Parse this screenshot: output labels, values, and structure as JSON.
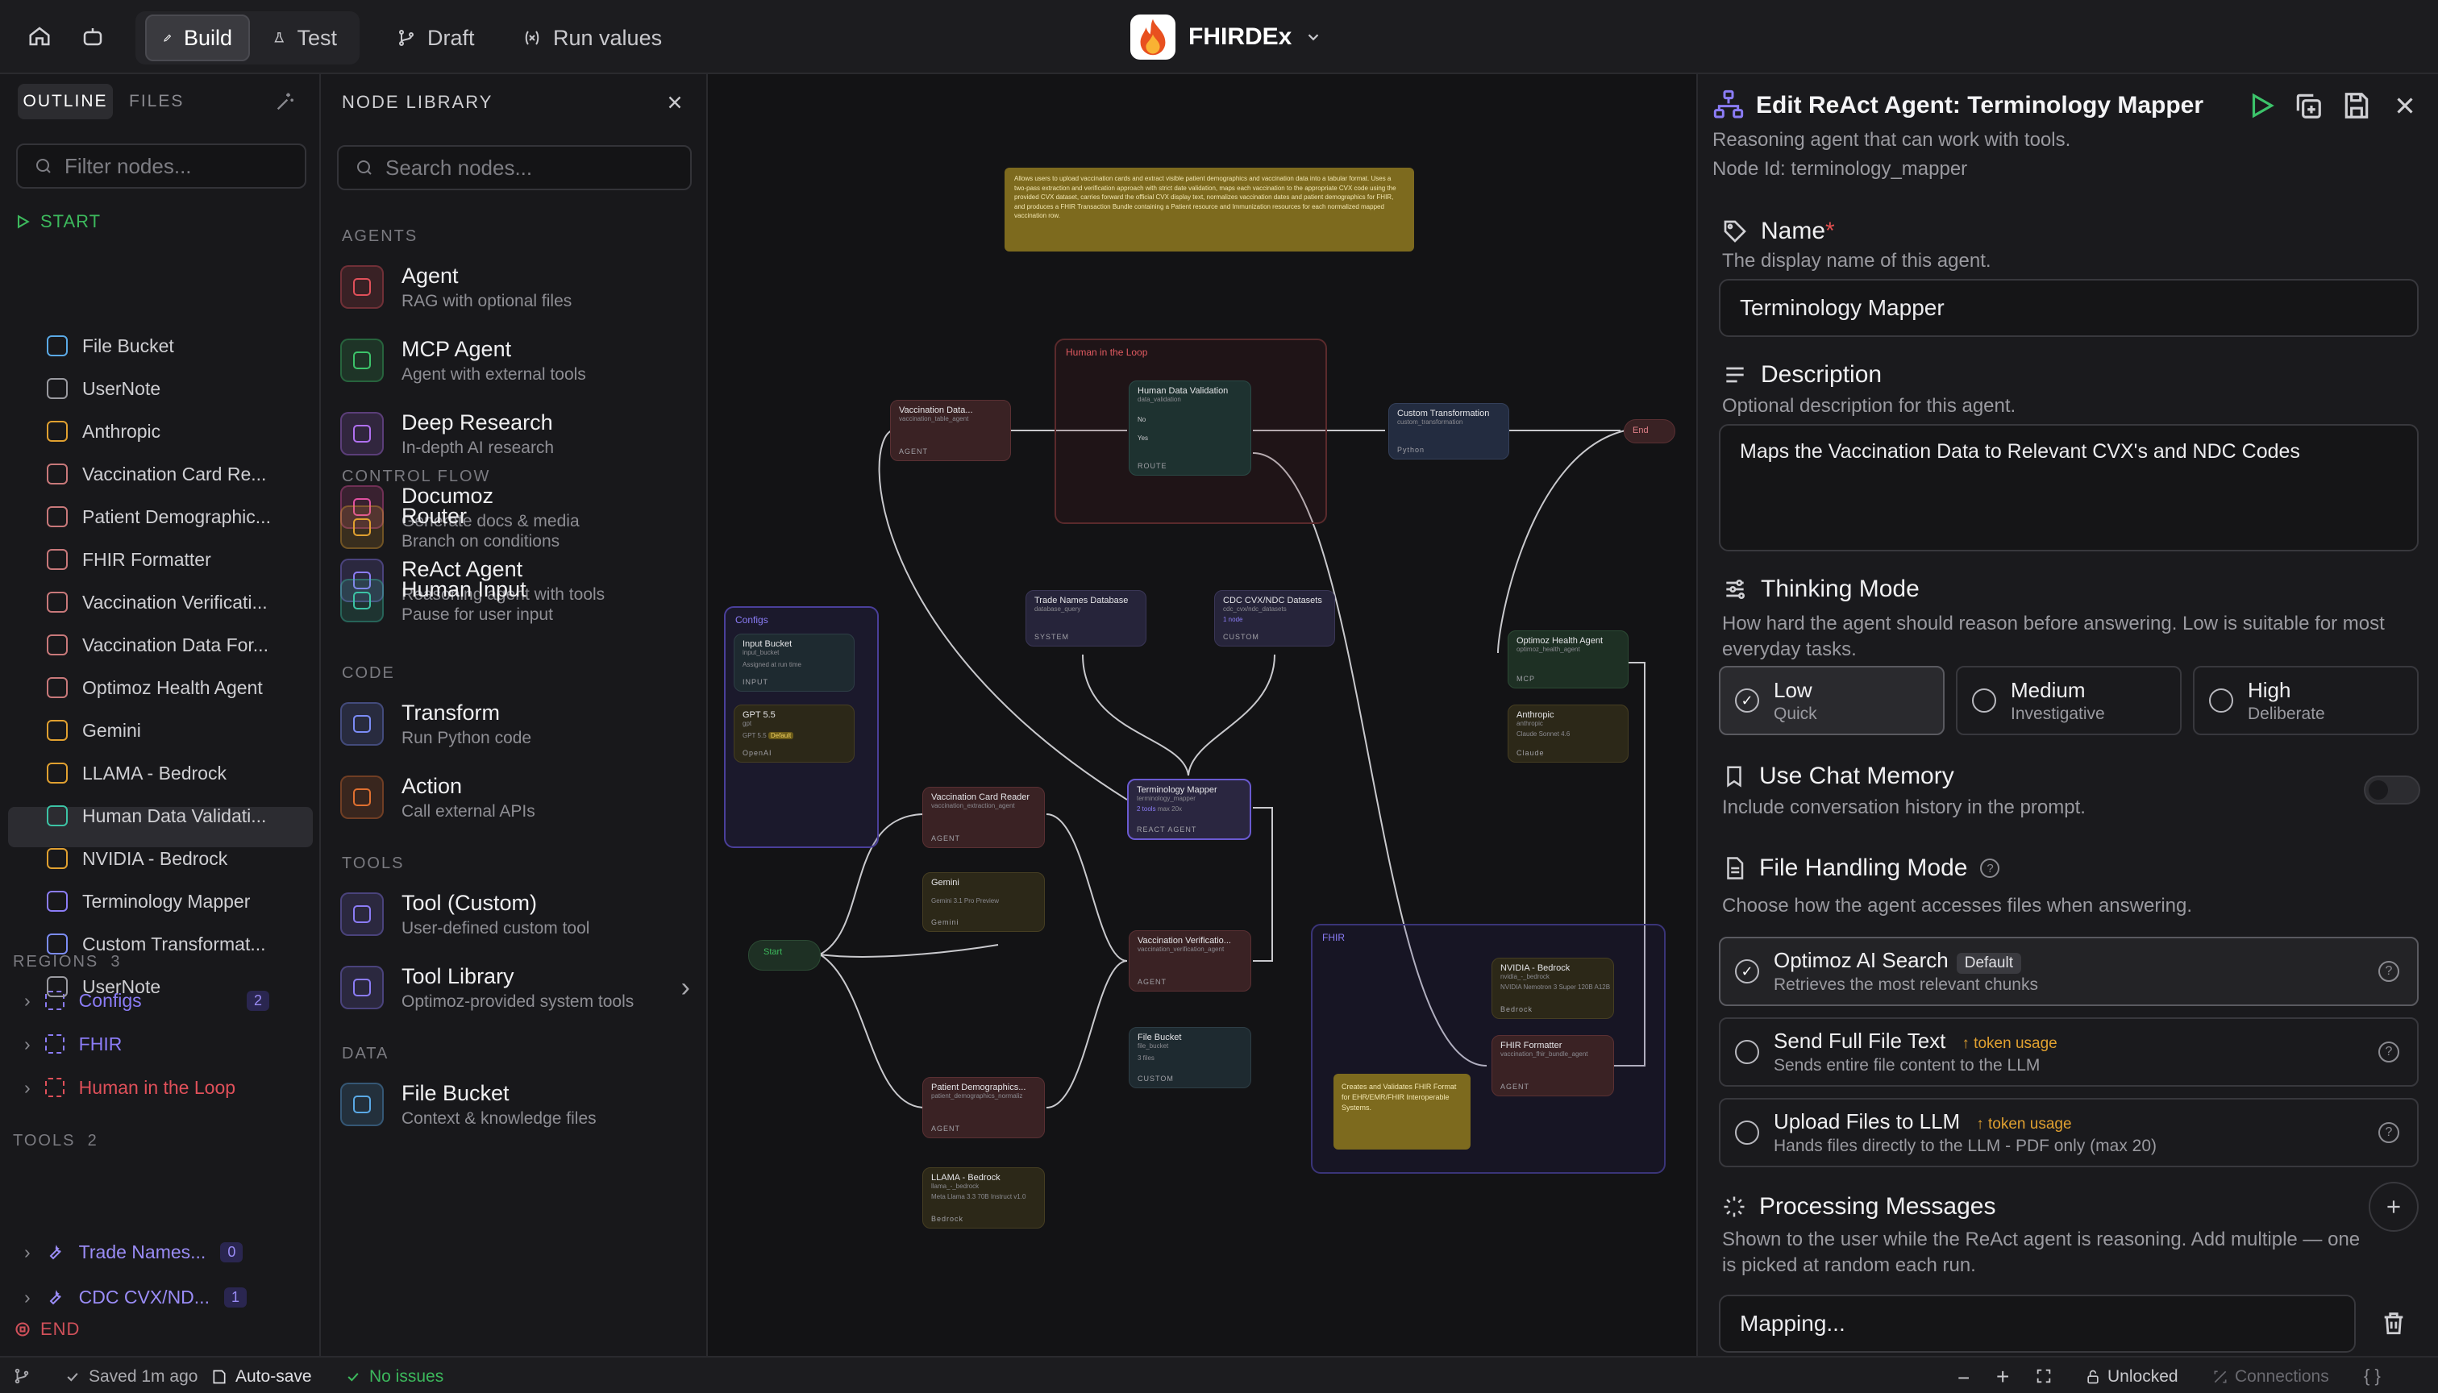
{
  "topbar": {
    "build": "Build",
    "test": "Test",
    "draft": "Draft",
    "run_values": "Run values",
    "app_name": "FHIRDEx"
  },
  "outline": {
    "tab_outline": "OUTLINE",
    "tab_files": "FILES",
    "filter_placeholder": "Filter nodes...",
    "start": "START",
    "items": [
      {
        "label": "File Bucket",
        "color": "#5aa9e6"
      },
      {
        "label": "UserNote",
        "color": "#9a9aa0"
      },
      {
        "label": "Anthropic",
        "color": "#e0a030"
      },
      {
        "label": "Vaccination Card Re...",
        "color": "#c8787a"
      },
      {
        "label": "Patient Demographic...",
        "color": "#c8787a"
      },
      {
        "label": "FHIR Formatter",
        "color": "#c8787a"
      },
      {
        "label": "Vaccination Verificati...",
        "color": "#c8787a"
      },
      {
        "label": "Vaccination Data For...",
        "color": "#c8787a"
      },
      {
        "label": "Optimoz Health Agent",
        "color": "#c8787a"
      },
      {
        "label": "Gemini",
        "color": "#e0a030"
      },
      {
        "label": "LLAMA - Bedrock",
        "color": "#e0a030"
      },
      {
        "label": "Human Data Validati...",
        "color": "#3cc3a5"
      },
      {
        "label": "NVIDIA - Bedrock",
        "color": "#e0a030"
      },
      {
        "label": "Terminology Mapper",
        "color": "#8b7cf6"
      },
      {
        "label": "Custom Transformat...",
        "color": "#7b8cf6"
      },
      {
        "label": "UserNote",
        "color": "#9a9aa0"
      }
    ],
    "regions_label": "REGIONS",
    "regions_count": "3",
    "regions": [
      {
        "label": "Configs",
        "count": "2",
        "color": "#8b7cf6"
      },
      {
        "label": "FHIR",
        "color": "#8b7cf6"
      },
      {
        "label": "Human in the Loop",
        "color": "#e0505a"
      }
    ],
    "tools_label": "TOOLS",
    "tools_count": "2",
    "tools": [
      {
        "label": "Trade Names...",
        "count": "0"
      },
      {
        "label": "CDC CVX/ND...",
        "count": "1"
      }
    ],
    "end": "END"
  },
  "library": {
    "title": "NODE LIBRARY",
    "search_placeholder": "Search nodes...",
    "sections": {
      "agents": "AGENTS",
      "control": "CONTROL FLOW",
      "code": "CODE",
      "tools": "TOOLS",
      "data": "DATA"
    },
    "agents": [
      {
        "name": "Agent",
        "desc": "RAG with optional files",
        "color": "#e0505a",
        "icon": "agent-icon"
      },
      {
        "name": "MCP Agent",
        "desc": "Agent with external tools",
        "color": "#3cc36a",
        "icon": "plug-icon"
      },
      {
        "name": "Deep Research",
        "desc": "In-depth AI research",
        "color": "#b070f0",
        "icon": "telescope-icon"
      },
      {
        "name": "Documoz",
        "desc": "Generate docs & media",
        "color": "#e050a0",
        "icon": "wand-icon"
      },
      {
        "name": "ReAct Agent",
        "desc": "Reasoning agent with tools",
        "color": "#8b7cf6",
        "icon": "network-icon"
      }
    ],
    "control": [
      {
        "name": "Router",
        "desc": "Branch on conditions",
        "color": "#e0a030",
        "icon": "fork-icon"
      },
      {
        "name": "Human Input",
        "desc": "Pause for user input",
        "color": "#3cc3a5",
        "icon": "user-icon"
      }
    ],
    "code": [
      {
        "name": "Transform",
        "desc": "Run Python code",
        "color": "#7b8cf6",
        "icon": "shuffle-icon"
      },
      {
        "name": "Action",
        "desc": "Call external APIs",
        "color": "#e07030",
        "icon": "rocket-icon"
      }
    ],
    "tools": [
      {
        "name": "Tool (Custom)",
        "desc": "User-defined custom tool",
        "color": "#8b7cf6",
        "icon": "wrench-icon"
      },
      {
        "name": "Tool Library",
        "desc": "Optimoz-provided system tools",
        "color": "#8b7cf6",
        "icon": "wrench-icon"
      }
    ],
    "data": [
      {
        "name": "File Bucket",
        "desc": "Context & knowledge files",
        "color": "#5aa9e6",
        "icon": "folder-icon"
      }
    ]
  },
  "canvas": {
    "note_top": "Allows users to upload vaccination cards and extract visible patient demographics and vaccination data into a tabular format. Uses a two-pass extraction and verification approach with strict date validation, maps each vaccination to the appropriate CVX code using the provided CVX dataset, carries forward the official CVX display text, normalizes vaccination dates and patient demographics for FHIR, and produces a FHIR Transaction Bundle containing a Patient resource and Immunization resources for each normalized mapped vaccination row.",
    "note_fhir": "Creates and Validates FHIR Format for EHR/EMR/FHIR Interoperable Systems.",
    "regions": {
      "hitl": "Human in the Loop",
      "configs": "Configs",
      "fhir": "FHIR"
    },
    "nodes": {
      "vdf": {
        "t": "Vaccination Data...",
        "s": "vaccination_table_agent",
        "f": "AGENT"
      },
      "hdv": {
        "t": "Human Data Validation",
        "s": "data_validation",
        "f": "ROUTE",
        "r1": "No",
        "r2": "Yes"
      },
      "ct": {
        "t": "Custom Transformation",
        "s": "custom_transformation",
        "f": "Python"
      },
      "end": {
        "t": "End"
      },
      "ib": {
        "t": "Input Bucket",
        "s": "input_bucket",
        "m": "Assigned at run time",
        "f": "INPUT"
      },
      "gpt": {
        "t": "GPT 5.5",
        "s": "gpt",
        "m": "GPT 5.5",
        "b": "Default",
        "f": "OpenAI"
      },
      "tnd": {
        "t": "Trade Names Database",
        "s": "database_query",
        "f": "SYSTEM"
      },
      "cdc": {
        "t": "CDC CVX/NDC Datasets",
        "s": "cdc_cvx/ndc_datasets",
        "m": "1 node",
        "f": "CUSTOM"
      },
      "oha": {
        "t": "Optimoz Health Agent",
        "s": "optimoz_health_agent",
        "f": "MCP"
      },
      "anth": {
        "t": "Anthropic",
        "s": "anthropic",
        "m": "Claude Sonnet 4.6",
        "f": "Claude"
      },
      "tm": {
        "t": "Terminology Mapper",
        "s": "terminology_mapper",
        "m": "2 tools",
        "m2": "max 20x",
        "f": "REACT AGENT"
      },
      "vcr": {
        "t": "Vaccination Card Reader",
        "s": "vaccination_extraction_agent",
        "f": "AGENT"
      },
      "gem": {
        "t": "Gemini",
        "s": "gemini",
        "m": "Gemini 3.1 Pro Preview",
        "f": "Gemini"
      },
      "start": {
        "t": "Start"
      },
      "vv": {
        "t": "Vaccination Verificatio...",
        "s": "vaccination_verification_agent",
        "f": "AGENT"
      },
      "fb": {
        "t": "File Bucket",
        "s": "file_bucket",
        "m": "3 files",
        "f": "CUSTOM"
      },
      "pd": {
        "t": "Patient Demographics...",
        "s": "patient_demographics_normaliz",
        "f": "AGENT"
      },
      "llama": {
        "t": "LLAMA - Bedrock",
        "s": "llama_-_bedrock",
        "m": "Meta Llama 3.3 70B Instruct v1.0",
        "f": "Bedrock"
      },
      "nv": {
        "t": "NVIDIA - Bedrock",
        "s": "nvidia_-_bedrock",
        "m": "NVIDIA Nemotron 3 Super 120B A12B",
        "f": "Bedrock"
      },
      "ff": {
        "t": "FHIR Formatter",
        "s": "vaccination_fhir_bundle_agent",
        "f": "AGENT"
      }
    }
  },
  "editor": {
    "title": "Edit ReAct Agent: Terminology Mapper",
    "subtitle": "Reasoning agent that can work with tools.",
    "node_id": "Node Id: terminology_mapper",
    "name_label": "Name",
    "name_required": "*",
    "name_help": "The display name of this agent.",
    "name_value": "Terminology Mapper",
    "desc_label": "Description",
    "desc_help": "Optional description for this agent.",
    "desc_value": "Maps the Vaccination Data to Relevant CVX's and NDC Codes",
    "thinking_label": "Thinking Mode",
    "thinking_help": "How hard the agent should reason before answering. Low is suitable for most everyday tasks.",
    "thinking_opts": [
      {
        "t": "Low",
        "s": "Quick"
      },
      {
        "t": "Medium",
        "s": "Investigative"
      },
      {
        "t": "High",
        "s": "Deliberate"
      }
    ],
    "memory_label": "Use Chat Memory",
    "memory_help": "Include conversation history in the prompt.",
    "fh_label": "File Handling Mode",
    "fh_help": "Choose how the agent accesses files when answering.",
    "fh_opts": [
      {
        "t": "Optimoz AI Search",
        "badge": "Default",
        "s": "Retrieves the most relevant chunks"
      },
      {
        "t": "Send Full File Text",
        "badge": "↑ token usage",
        "s": "Sends entire file content to the LLM"
      },
      {
        "t": "Upload Files to LLM",
        "badge": "↑ token usage",
        "s": "Hands files directly to the LLM - PDF only (max 20)"
      }
    ],
    "pm_label": "Processing Messages",
    "pm_help": "Shown to the user while the ReAct agent is reasoning. Add multiple — one is picked at random each run.",
    "pm_value": "Mapping..."
  },
  "status": {
    "saved": "Saved 1m ago",
    "autosave": "Auto-save",
    "issues": "No issues",
    "unlocked": "Unlocked",
    "connections": "Connections"
  }
}
